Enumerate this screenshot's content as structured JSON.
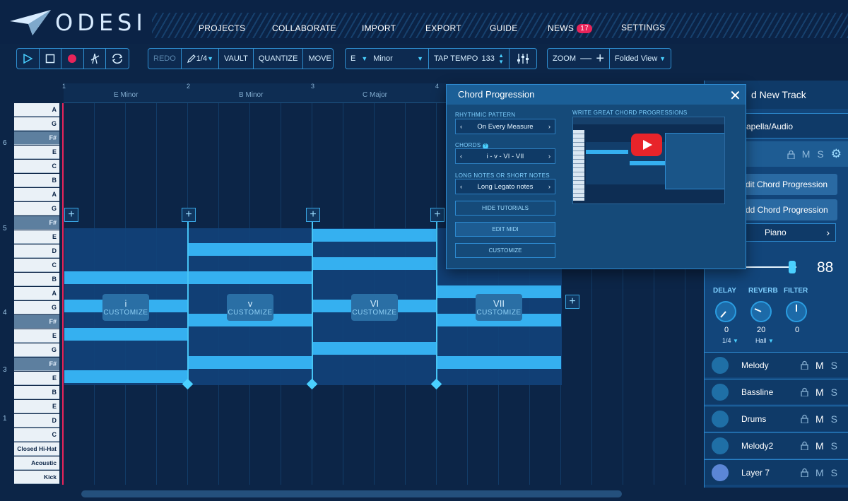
{
  "app": {
    "logo_text": "ODESI"
  },
  "nav": [
    {
      "label": "PROJECTS"
    },
    {
      "label": "COLLABORATE"
    },
    {
      "label": "IMPORT"
    },
    {
      "label": "EXPORT"
    },
    {
      "label": "GUIDE"
    },
    {
      "label": "NEWS",
      "badge": "17"
    },
    {
      "label": "SETTINGS"
    }
  ],
  "toolbar": {
    "redo": "REDO",
    "grid": "1/4",
    "vault": "VAULT",
    "quantize": "QUANTIZE",
    "move": "MOVE",
    "key": "E",
    "scale": "Minor",
    "tap_tempo": "TAP TEMPO",
    "tempo": "133",
    "zoom": "ZOOM",
    "view": "Folded View"
  },
  "ruler": {
    "bars": [
      "1",
      "2",
      "3",
      "4"
    ],
    "chords": [
      "E Minor",
      "B Minor",
      "C Major"
    ]
  },
  "keys": [
    "A",
    "G",
    "F#",
    "E",
    "C",
    "B",
    "A",
    "G",
    "F#",
    "E",
    "D",
    "C",
    "B",
    "A",
    "G",
    "F#",
    "E",
    "G",
    "F#",
    "E",
    "B",
    "E",
    "D",
    "C",
    "Closed Hi-Hat",
    "Acoustic Snare",
    "Kick"
  ],
  "octaves": [
    "6",
    "5",
    "4",
    "3",
    "1"
  ],
  "chord_blocks": [
    {
      "numeral": "i",
      "customize": "CUSTOMIZE"
    },
    {
      "numeral": "v",
      "customize": "CUSTOMIZE"
    },
    {
      "numeral": "VI",
      "customize": "CUSTOMIZE"
    },
    {
      "numeral": "VII",
      "customize": "CUSTOMIZE"
    }
  ],
  "modal": {
    "title": "Chord Progression",
    "rhythmic_label": "RHYTHMIC PATTERN",
    "rhythmic_value": "On Every Measure",
    "chords_label": "CHORDS",
    "chords_value": "i - v - VI - VII",
    "notes_label": "LONG NOTES OR SHORT NOTES",
    "notes_value": "Long Legato notes",
    "hide_tutorials": "HIDE TUTORIALS",
    "edit_midi": "EDIT MIDI",
    "customize": "CUSTOMIZE",
    "video_label": "WRITE GREAT CHORD PROGRESSIONS"
  },
  "panel": {
    "title": "d New Track",
    "track_type": "apella/Audio",
    "edit_chord": "dit Chord Progression",
    "add_chord": "dd Chord Progression",
    "instrument": "Piano",
    "volume": "88",
    "volume_level": 0.88,
    "fx": [
      {
        "label": "DELAY",
        "value": "0",
        "sub": "1/4"
      },
      {
        "label": "REVERB",
        "value": "20",
        "sub": "Hall"
      },
      {
        "label": "FILTER",
        "value": "0",
        "sub": ""
      }
    ],
    "m_label": "M",
    "s_label": "S",
    "tracks": [
      {
        "name": "Melody",
        "color": "#1f6fa6"
      },
      {
        "name": "Bassline",
        "color": "#1f6fa6"
      },
      {
        "name": "Drums",
        "color": "#1f6fa6"
      },
      {
        "name": "Melody2",
        "color": "#1f6fa6"
      },
      {
        "name": "Layer 7",
        "color": "#5b86d6"
      }
    ]
  },
  "colors": {
    "accent": "#35b0f0",
    "badge": "#e8245a",
    "background": "#0c2547"
  }
}
